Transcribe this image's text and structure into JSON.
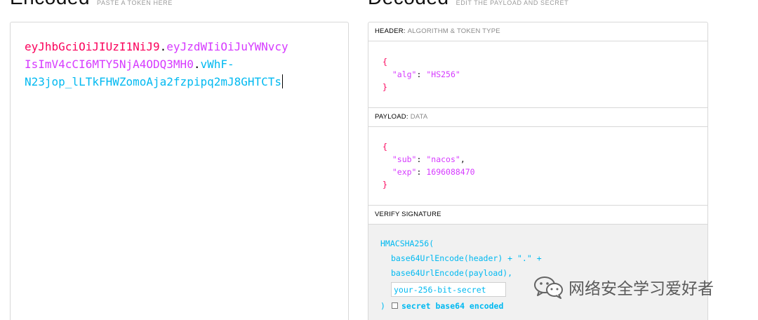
{
  "encoded": {
    "title": "Encoded",
    "hint": "PASTE A TOKEN HERE",
    "token_header": "eyJhbGciOiJIUzI1NiJ9",
    "dot1": ".",
    "token_payload_line1": "eyJzdWIiOiJuYWNvcy",
    "token_payload_line2": "IsImV4cCI6MTY5NjA4ODQ3MH0",
    "dot2": ".",
    "token_sig_line1": "vWhF-",
    "token_sig_line2": "N23jop_lLTkFHWZomoAja2fzpipq2mJ8GHTCTs"
  },
  "decoded": {
    "title": "Decoded",
    "hint": "EDIT THE PAYLOAD AND SECRET",
    "header": {
      "label": "HEADER:",
      "sub": "ALGORITHM & TOKEN TYPE",
      "open": "{",
      "key": "\"alg\"",
      "colon": ": ",
      "value": "\"HS256\"",
      "close": "}"
    },
    "payload": {
      "label": "PAYLOAD:",
      "sub": "DATA",
      "open": "{",
      "sub_key": "\"sub\"",
      "sub_value": "\"nacos\"",
      "comma": ",",
      "exp_key": "\"exp\"",
      "exp_value": "1696088470",
      "close": "}"
    },
    "verify": {
      "label": "VERIFY SIGNATURE",
      "line1": "HMACSHA256(",
      "line2": "base64UrlEncode(header) + \".\" +",
      "line3": "base64UrlEncode(payload),",
      "secret_placeholder": "your-256-bit-secret",
      "close": ")",
      "checkbox_label": "secret base64 encoded"
    }
  },
  "watermark": {
    "text": "网络安全学习爱好者",
    "icon": "wechat-icon"
  },
  "colors": {
    "header": "#fb015b",
    "payload": "#d63aff",
    "signature": "#00b9f1"
  }
}
